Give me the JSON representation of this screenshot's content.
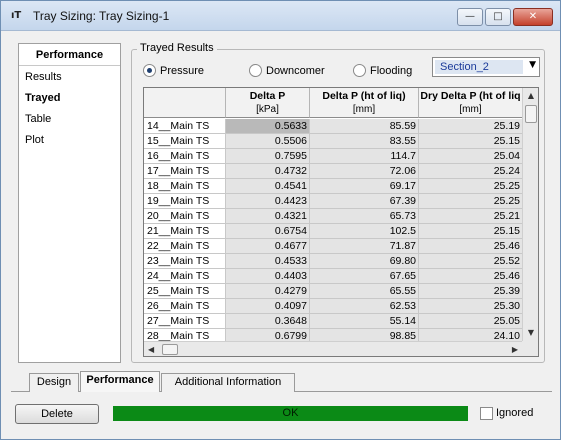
{
  "window": {
    "title": "Tray Sizing: Tray Sizing-1",
    "app_icon_text": "ıT",
    "minimize_glyph": "—",
    "maximize_glyph": "□",
    "close_glyph": "✕"
  },
  "sidebar": {
    "header": "Performance",
    "items": [
      {
        "label": "Results"
      },
      {
        "label": "Trayed"
      },
      {
        "label": "Table"
      },
      {
        "label": "Plot"
      }
    ],
    "selected": "Trayed"
  },
  "trayed_results": {
    "legend": "Trayed Results",
    "radios": [
      {
        "label": "Pressure",
        "checked": true
      },
      {
        "label": "Downcomer",
        "checked": false
      },
      {
        "label": "Flooding",
        "checked": false
      }
    ],
    "section_select": {
      "value": "Section_2",
      "arrow": "▼"
    }
  },
  "table": {
    "columns": [
      {
        "title": "Delta P",
        "unit": "[kPa]"
      },
      {
        "title": "Delta P (ht of liq)",
        "unit": "[mm]"
      },
      {
        "title": "Dry Delta P (ht of liq",
        "unit": "[mm]"
      }
    ],
    "rows": [
      {
        "label": "14__Main TS",
        "values": [
          "0.5633",
          "85.59",
          "25.19"
        ]
      },
      {
        "label": "15__Main TS",
        "values": [
          "0.5506",
          "83.55",
          "25.15"
        ]
      },
      {
        "label": "16__Main TS",
        "values": [
          "0.7595",
          "114.7",
          "25.04"
        ]
      },
      {
        "label": "17__Main TS",
        "values": [
          "0.4732",
          "72.06",
          "25.24"
        ]
      },
      {
        "label": "18__Main TS",
        "values": [
          "0.4541",
          "69.17",
          "25.25"
        ]
      },
      {
        "label": "19__Main TS",
        "values": [
          "0.4423",
          "67.39",
          "25.25"
        ]
      },
      {
        "label": "20__Main TS",
        "values": [
          "0.4321",
          "65.73",
          "25.21"
        ]
      },
      {
        "label": "21__Main TS",
        "values": [
          "0.6754",
          "102.5",
          "25.15"
        ]
      },
      {
        "label": "22__Main TS",
        "values": [
          "0.4677",
          "71.87",
          "25.46"
        ]
      },
      {
        "label": "23__Main TS",
        "values": [
          "0.4533",
          "69.80",
          "25.52"
        ]
      },
      {
        "label": "24__Main TS",
        "values": [
          "0.4403",
          "67.65",
          "25.46"
        ]
      },
      {
        "label": "25__Main TS",
        "values": [
          "0.4279",
          "65.55",
          "25.39"
        ]
      },
      {
        "label": "26__Main TS",
        "values": [
          "0.4097",
          "62.53",
          "25.30"
        ]
      },
      {
        "label": "27__Main TS",
        "values": [
          "0.3648",
          "55.14",
          "25.05"
        ]
      },
      {
        "label": "28__Main TS",
        "values": [
          "0.6799",
          "98.85",
          "24.10"
        ]
      }
    ],
    "selected_cell": "14__Main TS / Delta P"
  },
  "scroll": {
    "up": "▲",
    "down": "▼",
    "left": "◀",
    "right": "▶"
  },
  "tabs": [
    {
      "label": "Design",
      "active": false
    },
    {
      "label": "Performance",
      "active": true
    },
    {
      "label": "Additional Information",
      "active": false
    }
  ],
  "footer": {
    "delete_label": "Delete",
    "status_text": "OK",
    "status_color": "#0b8a16",
    "ignored_label": "Ignored",
    "ignored_checked": false
  }
}
